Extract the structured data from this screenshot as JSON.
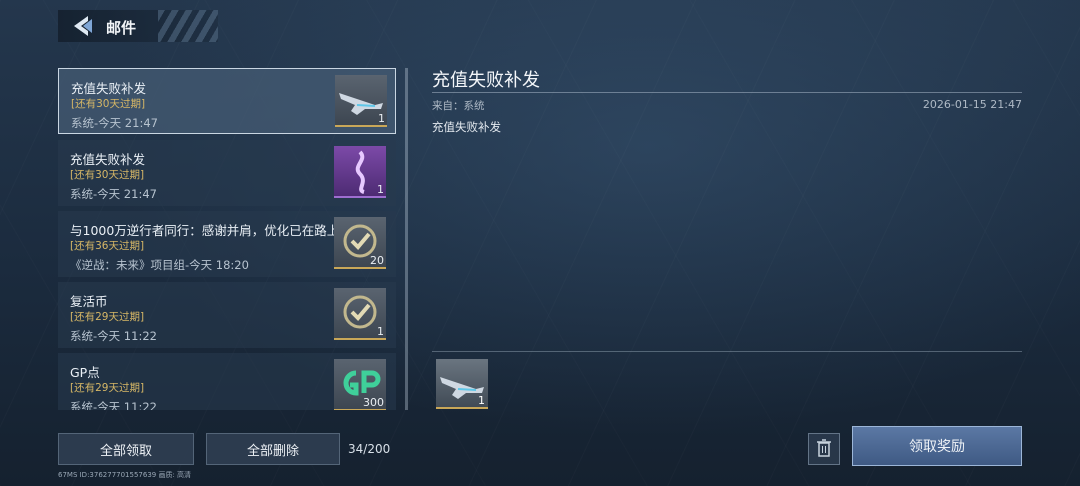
{
  "header": {
    "title": "邮件"
  },
  "mail_list": [
    {
      "title": "充值失败补发",
      "expire": "[还有30天过期]",
      "sub": "系统-今天 21:47",
      "count": "1",
      "selected": true
    },
    {
      "title": "充值失败补发",
      "expire": "[还有30天过期]",
      "sub": "系统-今天 21:47",
      "count": "1"
    },
    {
      "title": "与1000万逆行者同行：感谢并肩，优化已在路上",
      "expire": "[还有36天过期]",
      "sub": "《逆战：未来》项目组-今天 18:20",
      "count": "20"
    },
    {
      "title": "复活币",
      "expire": "[还有29天过期]",
      "sub": "系统-今天 11:22",
      "count": "1"
    },
    {
      "title": "GP点",
      "expire": "[还有29天过期]",
      "sub": "系统-今天 11:22",
      "count": "300"
    }
  ],
  "detail": {
    "title": "充值失败补发",
    "from": "来自：系统",
    "date": "2026-01-15 21:47",
    "body": "充值失败补发",
    "reward_count": "1"
  },
  "actions": {
    "claim_all": "全部领取",
    "delete_all": "全部删除",
    "mail_count": "34/200",
    "claim_reward": "领取奖励"
  },
  "footer": {
    "text": "67MS  ID:376277701557639  画质: 高清"
  },
  "colors": {
    "expire": "#d6b766",
    "claim_button": "#4e6a96"
  }
}
